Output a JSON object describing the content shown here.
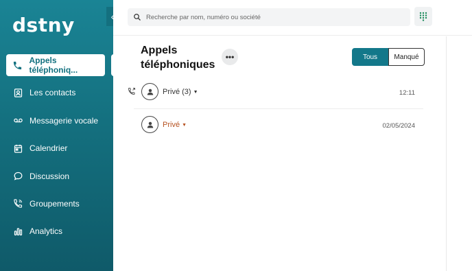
{
  "brand": {
    "logo": "dstny"
  },
  "sidebar": {
    "collapse_icon": "chevron-left-icon",
    "items": [
      {
        "label": "Appels téléphoniq...",
        "icon": "phone-icon",
        "active": true
      },
      {
        "label": "Les contacts",
        "icon": "contact-card-icon",
        "active": false
      },
      {
        "label": "Messagerie vocale",
        "icon": "voicemail-icon",
        "active": false
      },
      {
        "label": "Calendrier",
        "icon": "calendar-icon",
        "active": false
      },
      {
        "label": "Discussion",
        "icon": "chat-bubble-icon",
        "active": false
      },
      {
        "label": "Groupements",
        "icon": "group-phone-icon",
        "active": false
      },
      {
        "label": "Analytics",
        "icon": "bar-chart-icon",
        "active": false
      }
    ]
  },
  "topbar": {
    "search_placeholder": "Recherche par nom, numéro ou société",
    "dialpad_icon": "dialpad-icon"
  },
  "main": {
    "title": "Appels téléphoniques",
    "more_label": "•••",
    "filters": {
      "all": "Tous",
      "missed": "Manqué",
      "selected": "Tous"
    },
    "calls": [
      {
        "name": "Privé (3)",
        "time": "12:11",
        "missed": false,
        "direction_icon": "outgoing-call-icon"
      },
      {
        "name": "Privé",
        "time": "02/05/2024",
        "missed": true
      }
    ]
  },
  "colors": {
    "accent": "#13788a",
    "missed": "#b5501f",
    "sidebar_top": "#1a8495",
    "sidebar_bottom": "#0f5a69"
  }
}
